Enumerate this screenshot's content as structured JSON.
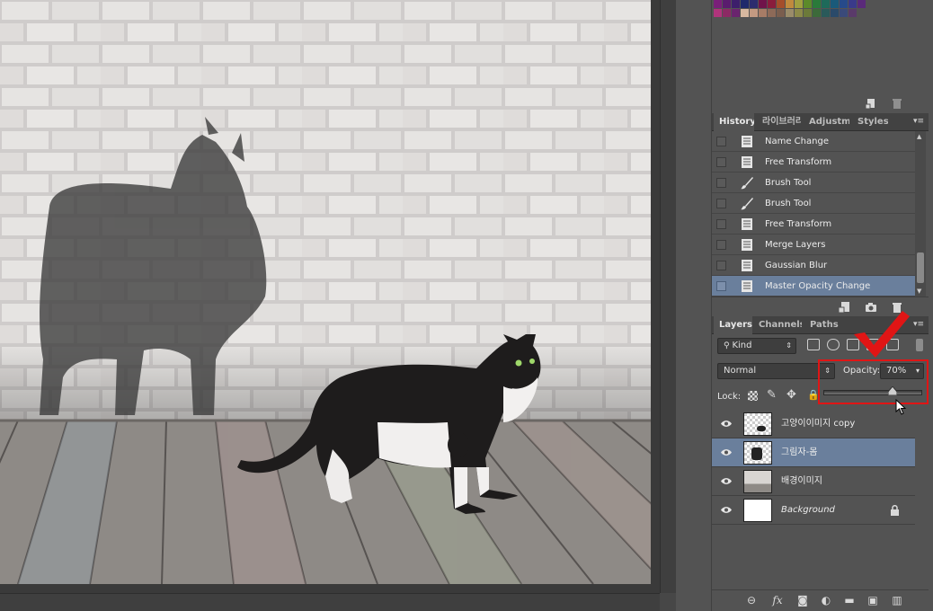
{
  "swatches": {
    "colors": [
      "#7a1f7a",
      "#5a1c6e",
      "#3d1f6b",
      "#1f2a6b",
      "#2c2c6e",
      "#70134a",
      "#8a1c3c",
      "#a44d2b",
      "#c08a3e",
      "#a0a040",
      "#5c8a2a",
      "#2a7a3a",
      "#1e6a5a",
      "#1a5a7a",
      "#264a8a",
      "#3a3a8a",
      "#5a2a7a",
      "#b0347c",
      "#8c2a64",
      "#6a246e",
      "#d7b8a0",
      "#c49a82",
      "#a77c66",
      "#8d6a58",
      "#7a5e4e",
      "#9a8c6a",
      "#8c8a4a",
      "#6c7a3a",
      "#3c6a3a",
      "#2a5a5a",
      "#2a4a6a",
      "#3a4a7a",
      "#5a3a6a"
    ],
    "toolbar_icons": [
      "new-swatch-icon",
      "trash-icon"
    ]
  },
  "history": {
    "tabs": [
      "History",
      "라이브러리",
      "Adjustme",
      "Styles"
    ],
    "items": [
      {
        "label": "Name Change",
        "icon": "document-icon"
      },
      {
        "label": "Free Transform",
        "icon": "document-icon"
      },
      {
        "label": "Brush Tool",
        "icon": "brush-icon"
      },
      {
        "label": "Brush Tool",
        "icon": "brush-icon"
      },
      {
        "label": "Free Transform",
        "icon": "document-icon"
      },
      {
        "label": "Merge Layers",
        "icon": "document-icon"
      },
      {
        "label": "Gaussian Blur",
        "icon": "document-icon"
      },
      {
        "label": "Master Opacity Change",
        "icon": "document-icon"
      }
    ],
    "selected_index": 7,
    "toolbar_icons": [
      "new-document-from-state-icon",
      "camera-icon",
      "trash-icon"
    ]
  },
  "layers": {
    "tabs": [
      "Layers",
      "Channels",
      "Paths"
    ],
    "filter_label": "Kind",
    "blend_mode": "Normal",
    "opacity_label": "Opacity:",
    "opacity_value": "70%",
    "opacity_fraction": 0.7,
    "lock_label": "Lock:",
    "items": [
      {
        "name": "고양이이미지 copy",
        "thumb": "cat-copy",
        "italic": false,
        "locked": false
      },
      {
        "name": "그림자-몸",
        "thumb": "shadow",
        "italic": false,
        "locked": false
      },
      {
        "name": "배경이미지",
        "thumb": "bg-image",
        "italic": false,
        "locked": false
      },
      {
        "name": "Background",
        "thumb": "white",
        "italic": true,
        "locked": true
      }
    ],
    "selected_index": 1,
    "footer_icons": [
      "link-icon",
      "fx-icon",
      "mask-icon",
      "adjustment-icon",
      "folder-icon",
      "new-layer-icon",
      "trash-icon"
    ]
  },
  "colors": {
    "panel_bg": "#535353",
    "selection": "#6a7f9c",
    "highlight": "#e01515"
  }
}
